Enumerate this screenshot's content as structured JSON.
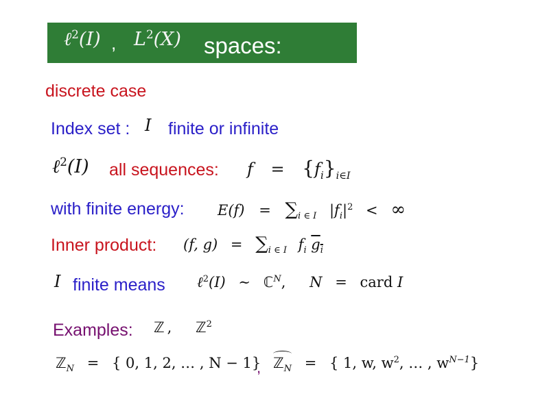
{
  "slide": {
    "title": {
      "math_part1": "ℓ",
      "math_part1_sup": "2",
      "math_part1_arg": "(I)",
      "separator": ",",
      "math_part2": "L",
      "math_part2_sup": "2",
      "math_part2_arg": "(X)",
      "text": "spaces:"
    },
    "subtitle": "discrete case",
    "index_set": {
      "label": "Index set :",
      "symbol": "I",
      "description": "finite or infinite"
    },
    "sequences": {
      "space": "ℓ",
      "space_sup": "2",
      "space_arg": "(I)",
      "label": "all sequences:",
      "formula_lhs": "f",
      "formula_eq": "=",
      "formula_rhs_open": "{",
      "formula_rhs_f": "f",
      "formula_rhs_sub": "i",
      "formula_rhs_close": "}",
      "formula_rhs_index": "i∈I"
    },
    "energy": {
      "label": "with finite energy:",
      "lhs": "E(f)",
      "eq": "=",
      "sum": "∑",
      "sum_index": "i ∈ I",
      "term": "|f",
      "term_sub": "i",
      "term_close": "|",
      "term_sup": "2",
      "lt": "<",
      "infinity": "∞"
    },
    "inner_product": {
      "label": "Inner product:",
      "lhs": "(f, g)",
      "eq": "=",
      "sum": "∑",
      "sum_index": "i ∈ I",
      "f": "f",
      "f_sub": "i",
      "g": "g",
      "g_sub": "i"
    },
    "finite": {
      "symbol": "I",
      "label": "finite means",
      "space": "ℓ",
      "space_sup": "2",
      "space_arg": "(I)",
      "sim": "∼",
      "cn": "ℂ",
      "cn_sup": "N",
      "comma": ",",
      "n": "N",
      "eq": "=",
      "card": "card",
      "card_arg": "I"
    },
    "examples": {
      "label": "Examples:",
      "z": "ℤ",
      "comma": ",",
      "z2": "ℤ",
      "z2_sup": "2"
    },
    "zn": {
      "lhs": "ℤ",
      "lhs_sub": "N",
      "eq": "=",
      "set": "{ 0, 1, 2, … , N − 1}",
      "separator": ",",
      "hat_lhs": "ℤ",
      "hat_lhs_sub": "N",
      "hat_eq": "=",
      "hat_set_open": "{ 1, w, w",
      "hat_set_sup2": "2",
      "hat_set_mid": ", … , w",
      "hat_set_supN": "N−1",
      "hat_set_close": "}"
    },
    "colors": {
      "title_bg": "#2f7d36",
      "red": "#c8141e",
      "blue": "#2a1fc8",
      "purple": "#76106f"
    }
  }
}
